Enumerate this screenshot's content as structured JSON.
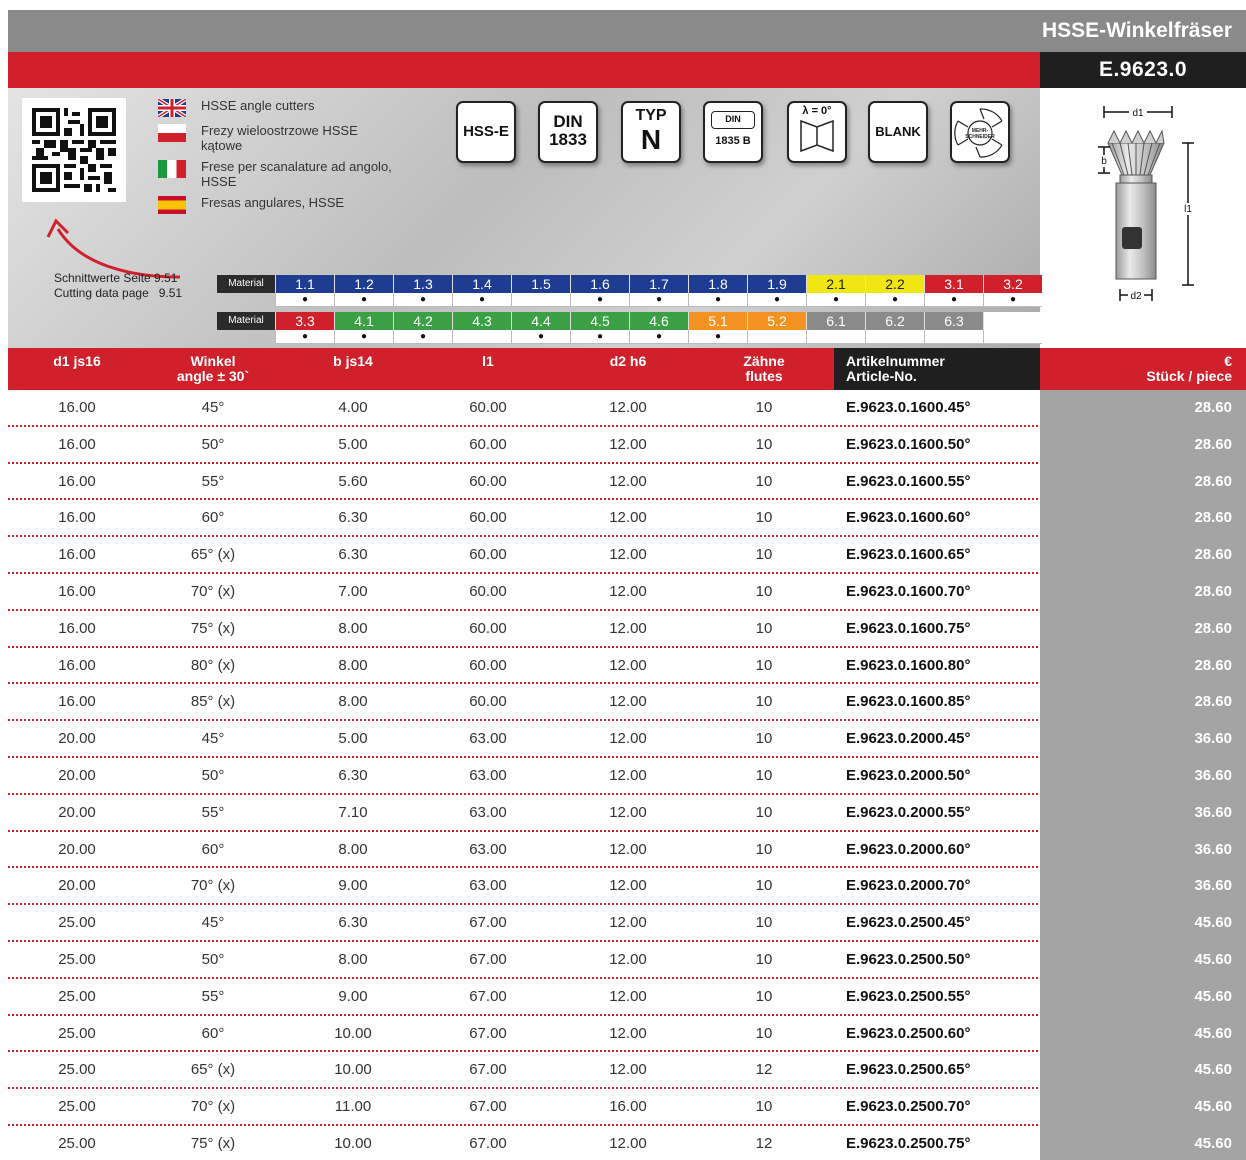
{
  "header": {
    "title": "HSSE-Winkelfräser",
    "code": "E.9623.0"
  },
  "languages": [
    {
      "flag": "uk",
      "text": "HSSE angle cutters"
    },
    {
      "flag": "pl",
      "text": "Frezy wieloostrzowe HSSE kątowe"
    },
    {
      "flag": "it",
      "text": "Frese per scanalature ad angolo, HSSE"
    },
    {
      "flag": "es",
      "text": "Fresas angulares, HSSE"
    }
  ],
  "reference": {
    "line1": "Schnittwerte Seite 9.51",
    "line2": "Cutting data page   9.51"
  },
  "badges": {
    "hss": "HSS-E",
    "din_line1": "DIN",
    "din_line2": "1833",
    "typ_line1": "TYP",
    "typ_line2": "N",
    "din2_line1": "DIN",
    "din2_line2": "1835 B",
    "lambda": "λ = 0°",
    "blank": "BLANK",
    "mehr": "MEHR-SCHNEIDER"
  },
  "materials": {
    "label": "Material",
    "row1": [
      {
        "code": "1.1",
        "color": "blue",
        "dot": "●"
      },
      {
        "code": "1.2",
        "color": "blue",
        "dot": "●"
      },
      {
        "code": "1.3",
        "color": "blue",
        "dot": "●"
      },
      {
        "code": "1.4",
        "color": "blue",
        "dot": "●"
      },
      {
        "code": "1.5",
        "color": "blue",
        "dot": ""
      },
      {
        "code": "1.6",
        "color": "blue",
        "dot": "●"
      },
      {
        "code": "1.7",
        "color": "blue",
        "dot": "●"
      },
      {
        "code": "1.8",
        "color": "blue",
        "dot": "●"
      },
      {
        "code": "1.9",
        "color": "blue",
        "dot": "●"
      },
      {
        "code": "2.1",
        "color": "yellow",
        "dot": "●"
      },
      {
        "code": "2.2",
        "color": "yellow",
        "dot": "●"
      },
      {
        "code": "3.1",
        "color": "red",
        "dot": "●"
      },
      {
        "code": "3.2",
        "color": "red",
        "dot": "●"
      }
    ],
    "row2": [
      {
        "code": "3.3",
        "color": "red",
        "dot": "●"
      },
      {
        "code": "4.1",
        "color": "green",
        "dot": "●"
      },
      {
        "code": "4.2",
        "color": "green",
        "dot": "●"
      },
      {
        "code": "4.3",
        "color": "green",
        "dot": ""
      },
      {
        "code": "4.4",
        "color": "green",
        "dot": "●"
      },
      {
        "code": "4.5",
        "color": "green",
        "dot": "●"
      },
      {
        "code": "4.6",
        "color": "green",
        "dot": "●"
      },
      {
        "code": "5.1",
        "color": "orange",
        "dot": "●"
      },
      {
        "code": "5.2",
        "color": "orange",
        "dot": ""
      },
      {
        "code": "6.1",
        "color": "gray",
        "dot": ""
      },
      {
        "code": "6.2",
        "color": "gray",
        "dot": ""
      },
      {
        "code": "6.3",
        "color": "gray",
        "dot": ""
      },
      {
        "code": "",
        "color": "empty",
        "dot": ""
      }
    ]
  },
  "drawing": {
    "d1": "d1",
    "b": "b",
    "l1": "l1",
    "d2": "d2"
  },
  "table": {
    "headers": {
      "d1": "d1 js16",
      "winkel1": "Winkel",
      "winkel2": "angle ± 30`",
      "b": "b js14",
      "l1": "l1",
      "d2": "d2 h6",
      "z1": "Zähne",
      "z2": "flutes",
      "art1": "Artikelnummer",
      "art2": "Article-No.",
      "price1": "€",
      "price2": "Stück / piece"
    },
    "rows": [
      [
        "16.00",
        "45°",
        "4.00",
        "60.00",
        "12.00",
        "10",
        "E.9623.0.1600.45°",
        "28.60"
      ],
      [
        "16.00",
        "50°",
        "5.00",
        "60.00",
        "12.00",
        "10",
        "E.9623.0.1600.50°",
        "28.60"
      ],
      [
        "16.00",
        "55°",
        "5.60",
        "60.00",
        "12.00",
        "10",
        "E.9623.0.1600.55°",
        "28.60"
      ],
      [
        "16.00",
        "60°",
        "6.30",
        "60.00",
        "12.00",
        "10",
        "E.9623.0.1600.60°",
        "28.60"
      ],
      [
        "16.00",
        "65° (x)",
        "6.30",
        "60.00",
        "12.00",
        "10",
        "E.9623.0.1600.65°",
        "28.60"
      ],
      [
        "16.00",
        "70° (x)",
        "7.00",
        "60.00",
        "12.00",
        "10",
        "E.9623.0.1600.70°",
        "28.60"
      ],
      [
        "16.00",
        "75° (x)",
        "8.00",
        "60.00",
        "12.00",
        "10",
        "E.9623.0.1600.75°",
        "28.60"
      ],
      [
        "16.00",
        "80° (x)",
        "8.00",
        "60.00",
        "12.00",
        "10",
        "E.9623.0.1600.80°",
        "28.60"
      ],
      [
        "16.00",
        "85° (x)",
        "8.00",
        "60.00",
        "12.00",
        "10",
        "E.9623.0.1600.85°",
        "28.60"
      ],
      [
        "20.00",
        "45°",
        "5.00",
        "63.00",
        "12.00",
        "10",
        "E.9623.0.2000.45°",
        "36.60"
      ],
      [
        "20.00",
        "50°",
        "6.30",
        "63.00",
        "12.00",
        "10",
        "E.9623.0.2000.50°",
        "36.60"
      ],
      [
        "20.00",
        "55°",
        "7.10",
        "63.00",
        "12.00",
        "10",
        "E.9623.0.2000.55°",
        "36.60"
      ],
      [
        "20.00",
        "60°",
        "8.00",
        "63.00",
        "12.00",
        "10",
        "E.9623.0.2000.60°",
        "36.60"
      ],
      [
        "20.00",
        "70° (x)",
        "9.00",
        "63.00",
        "12.00",
        "10",
        "E.9623.0.2000.70°",
        "36.60"
      ],
      [
        "25.00",
        "45°",
        "6.30",
        "67.00",
        "12.00",
        "10",
        "E.9623.0.2500.45°",
        "45.60"
      ],
      [
        "25.00",
        "50°",
        "8.00",
        "67.00",
        "12.00",
        "10",
        "E.9623.0.2500.50°",
        "45.60"
      ],
      [
        "25.00",
        "55°",
        "9.00",
        "67.00",
        "12.00",
        "10",
        "E.9623.0.2500.55°",
        "45.60"
      ],
      [
        "25.00",
        "60°",
        "10.00",
        "67.00",
        "12.00",
        "10",
        "E.9623.0.2500.60°",
        "45.60"
      ],
      [
        "25.00",
        "65° (x)",
        "10.00",
        "67.00",
        "12.00",
        "12",
        "E.9623.0.2500.65°",
        "45.60"
      ],
      [
        "25.00",
        "70° (x)",
        "11.00",
        "67.00",
        "16.00",
        "10",
        "E.9623.0.2500.70°",
        "45.60"
      ],
      [
        "25.00",
        "75° (x)",
        "10.00",
        "67.00",
        "12.00",
        "12",
        "E.9623.0.2500.75°",
        "45.60"
      ]
    ]
  }
}
